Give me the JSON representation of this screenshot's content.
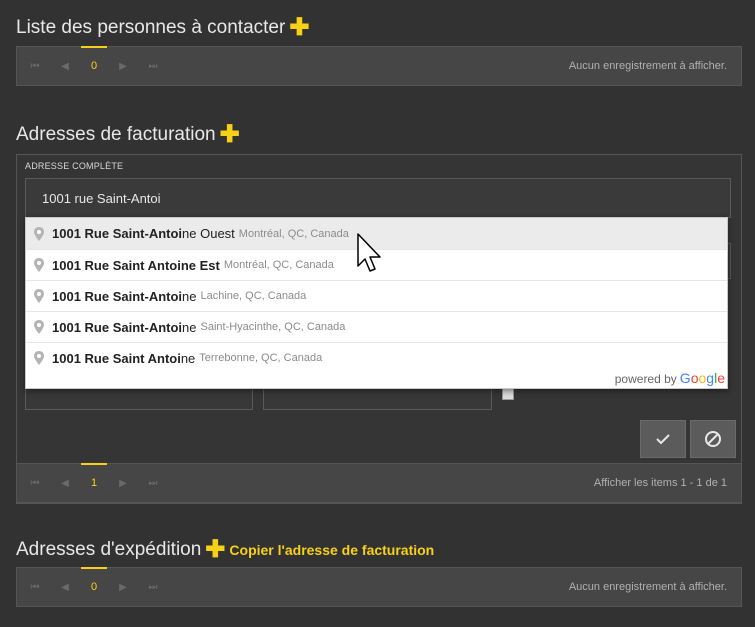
{
  "contacts": {
    "title": "Liste des personnes à contacter",
    "add_icon": "plus-icon",
    "pager": {
      "page": "0",
      "info": "Aucun enregistrement à afficher."
    }
  },
  "billing": {
    "title": "Adresses de facturation",
    "add_icon": "plus-icon",
    "field_label": "ADRESSE COMPLÈTE",
    "address_value": "1001 rue Saint-Antoi",
    "suggestions": [
      {
        "match": "1001 Rue Saint-Antoi",
        "rest": "ne Ouest",
        "secondary": "Montréal, QC, Canada"
      },
      {
        "match": "1001 Rue Saint Antoine Est",
        "rest": "",
        "secondary": "Montréal, QC, Canada"
      },
      {
        "match": "1001 Rue Saint-Antoi",
        "rest": "ne",
        "secondary": "Lachine, QC, Canada"
      },
      {
        "match": "1001 Rue Saint-Antoi",
        "rest": "ne",
        "secondary": "Saint-Hyacinthe, QC, Canada"
      },
      {
        "match": "1001 Rue Saint Antoi",
        "rest": "ne",
        "secondary": "Terrebonne, QC, Canada"
      }
    ],
    "powered_by": "powered by",
    "google": [
      "G",
      "o",
      "o",
      "g",
      "l",
      "e"
    ],
    "save_icon": "checkmark-icon",
    "cancel_icon": "cancel-icon",
    "pager": {
      "page": "1",
      "info": "Afficher les items 1 - 1 de 1"
    }
  },
  "shipping": {
    "title": "Adresses d'expédition",
    "add_icon": "plus-icon",
    "copy_link": "Copier l'adresse de facturation",
    "pager": {
      "page": "0",
      "info": "Aucun enregistrement à afficher."
    }
  },
  "pager_icons": [
    "first-page-icon",
    "previous-page-icon",
    "next-page-icon",
    "last-page-icon"
  ],
  "colors": {
    "accent": "#f7d117",
    "background": "#323232",
    "panel": "#464646"
  }
}
